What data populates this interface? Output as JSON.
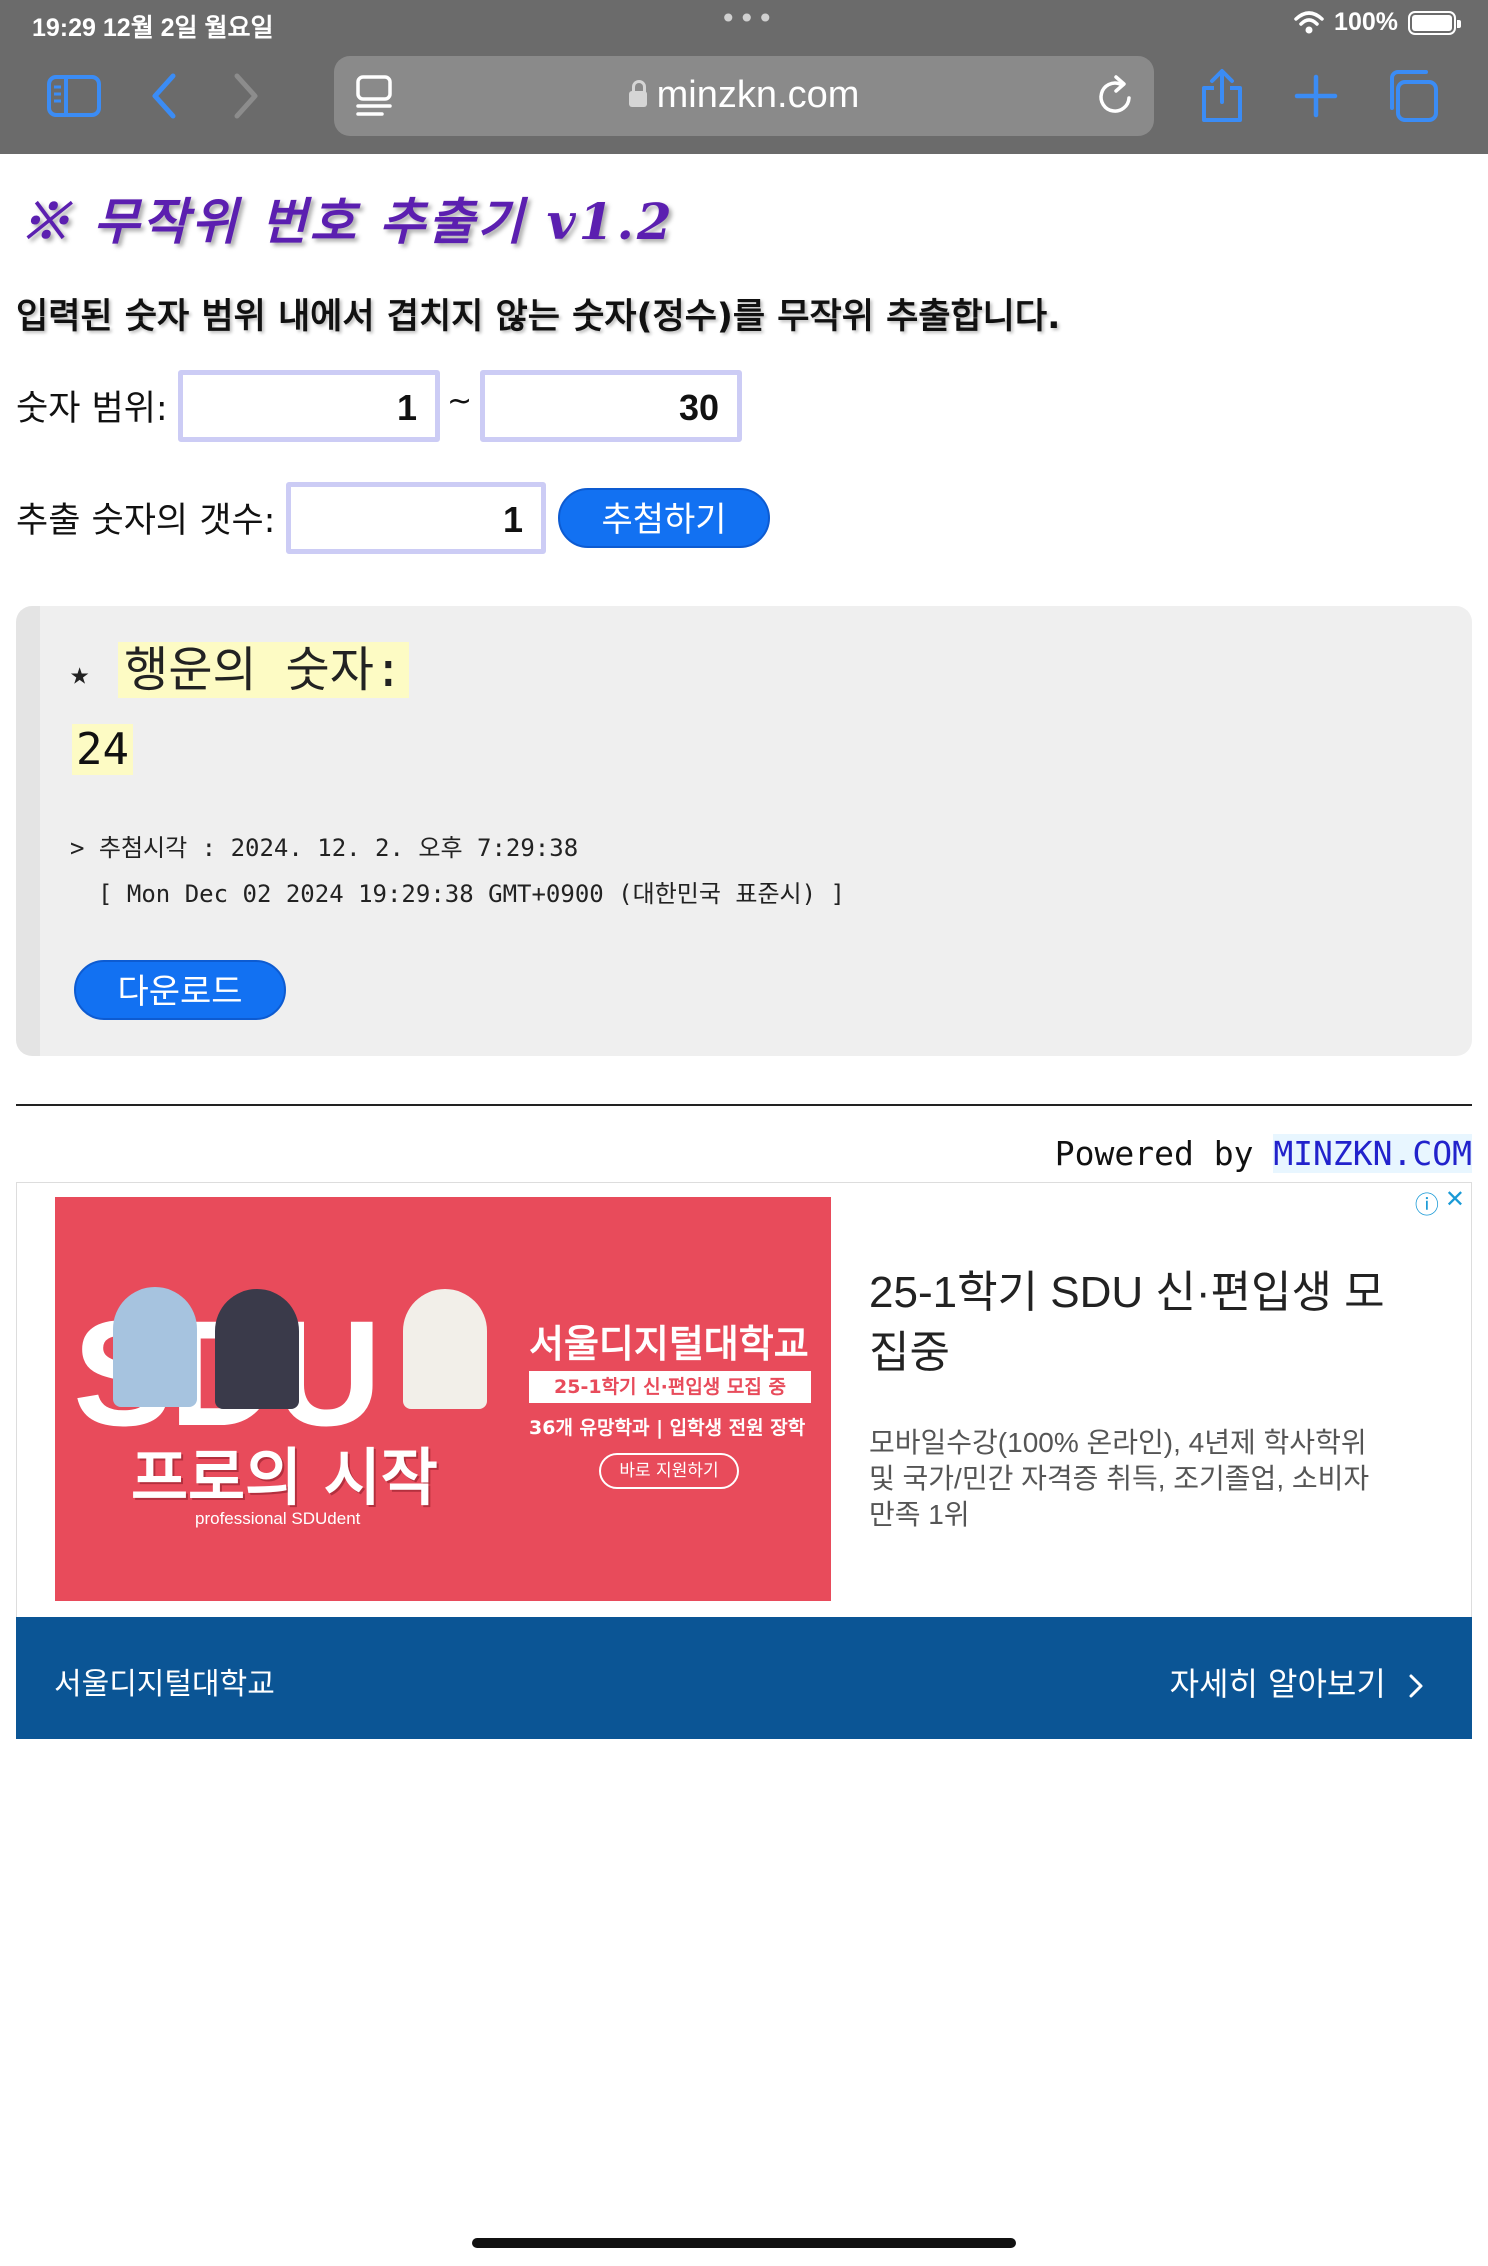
{
  "status_bar": {
    "time": "19:29  12월 2일 월요일",
    "battery": "100%",
    "battery_level": 1.0
  },
  "browser": {
    "url": "minzkn.com"
  },
  "page": {
    "title": "※ 무작위 번호 추출기 v1.2",
    "description": "입력된 숫자 범위 내에서 겹치지 않는 숫자(정수)를 무작위 추출합니다.",
    "range_label": "숫자 범위:",
    "range_min": "1",
    "range_sep": "~",
    "range_max": "30",
    "count_label": "추출 숫자의 갯수:",
    "count_value": "1",
    "draw_button": "추첨하기"
  },
  "result": {
    "title": "행운의 숫자:",
    "star": "★",
    "number": "24",
    "time_line": "> 추첨시각 : 2024. 12. 2. 오후 7:29:38",
    "time_detail": "[ Mon Dec 02 2024 19:29:38 GMT+0900 (대한민국 표준시) ]",
    "download_button": "다운로드"
  },
  "powered": {
    "prefix": "Powered by ",
    "brand": "MINZKN.COM"
  },
  "ad": {
    "image": {
      "big_text": "SDU",
      "slogan": "프로의 시작",
      "slogan_sub": "professional SDUdent",
      "univ": "서울디지털대학교",
      "recruit": "25-1학기 신·편입생 모집 중",
      "line": "36개 유망학과 | 입학생 전원 장학",
      "apply": "바로 지원하기"
    },
    "headline": "25-1학기 SDU 신·편입생 모집중",
    "body": "모바일수강(100% 온라인), 4년제 학사학위 및 국가/민간 자격증 취득, 조기졸업, 소비자만족 1위",
    "footer_left": "서울디지털대학교",
    "footer_right": "자세히 알아보기"
  }
}
